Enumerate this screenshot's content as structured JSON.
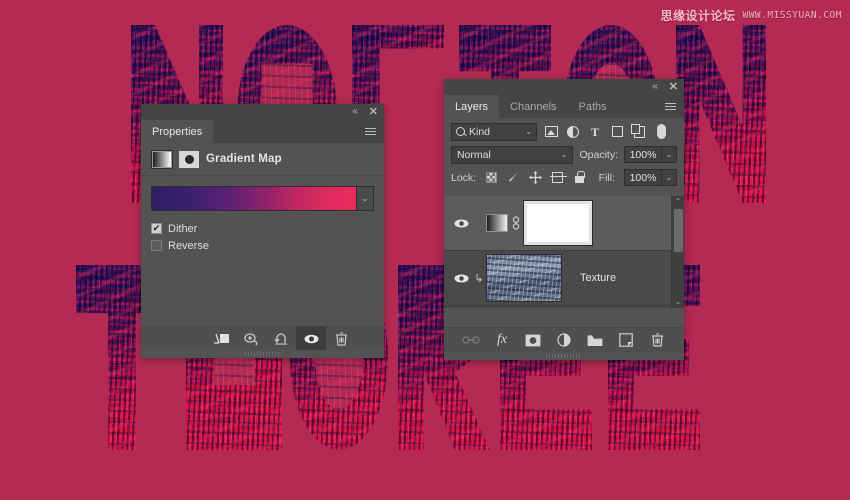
{
  "canvas": {
    "background_color": "#b32a54",
    "artwork_description": "Large duotone letterforms filled with a city skyline photo"
  },
  "watermark": {
    "chinese": "思缘设计论坛",
    "url": "WWW.MISSYUAN.COM"
  },
  "properties_panel": {
    "tab_label": "Properties",
    "collapse_icon": "«",
    "close_icon": "✕",
    "menu_icon": "hamburger-icon",
    "adjustment_title": "Gradient Map",
    "gradient": {
      "stops": [
        "#2d2061",
        "#3a2170",
        "#5c2075",
        "#8e2268",
        "#c32760",
        "#e2295e",
        "#ea2a5b"
      ],
      "dropdown_icon": "⌄"
    },
    "options": [
      {
        "label": "Dither",
        "checked": true
      },
      {
        "label": "Reverse",
        "checked": false
      }
    ],
    "footer_buttons": [
      {
        "name": "clip-to-layer-button",
        "glyph": "↵"
      },
      {
        "name": "previous-state-button",
        "glyph": "⟳"
      },
      {
        "name": "reset-button",
        "glyph": "↺"
      },
      {
        "name": "toggle-visibility-button",
        "glyph": "eye",
        "active": true
      },
      {
        "name": "delete-button",
        "glyph": "trash"
      }
    ]
  },
  "layers_panel": {
    "collapse_icon": "«",
    "close_icon": "✕",
    "tabs": [
      {
        "label": "Layers",
        "active": true
      },
      {
        "label": "Channels",
        "active": false
      },
      {
        "label": "Paths",
        "active": false
      }
    ],
    "filter": {
      "kind_label": "Kind",
      "caret": "⌄",
      "icons": [
        "pixel-filter-icon",
        "adjustment-filter-icon",
        "type-filter-icon",
        "shape-filter-icon",
        "smart-object-filter-icon",
        "filter-toggle-pill"
      ]
    },
    "blend": {
      "mode": "Normal",
      "caret": "⌄",
      "opacity_label": "Opacity:",
      "opacity_value": "100%"
    },
    "lock": {
      "label": "Lock:",
      "icons": [
        "lock-transparent-pixels-icon",
        "lock-image-pixels-icon",
        "lock-position-icon",
        "lock-artboard-nesting-icon",
        "lock-all-icon"
      ],
      "fill_label": "Fill:",
      "fill_value": "100%"
    },
    "layers": [
      {
        "name": "",
        "type": "gradient-map-adjustment",
        "visible": true,
        "selected": true,
        "has_mask": true,
        "linked": true
      },
      {
        "name": "Texture",
        "type": "image",
        "visible": true,
        "selected": false,
        "clipped": true
      }
    ],
    "scrollbar": {
      "up_arrow": "⌃",
      "down_arrow": "⌄"
    },
    "footer_buttons": [
      {
        "name": "link-layers-button",
        "glyph": "GO",
        "dimmed": true
      },
      {
        "name": "layer-style-button",
        "glyph": "fx"
      },
      {
        "name": "add-mask-button",
        "glyph": "mask"
      },
      {
        "name": "new-adjustment-layer-button",
        "glyph": "adjustment"
      },
      {
        "name": "new-group-button",
        "glyph": "folder"
      },
      {
        "name": "new-layer-button",
        "glyph": "new"
      },
      {
        "name": "delete-layer-button",
        "glyph": "trash"
      }
    ]
  }
}
